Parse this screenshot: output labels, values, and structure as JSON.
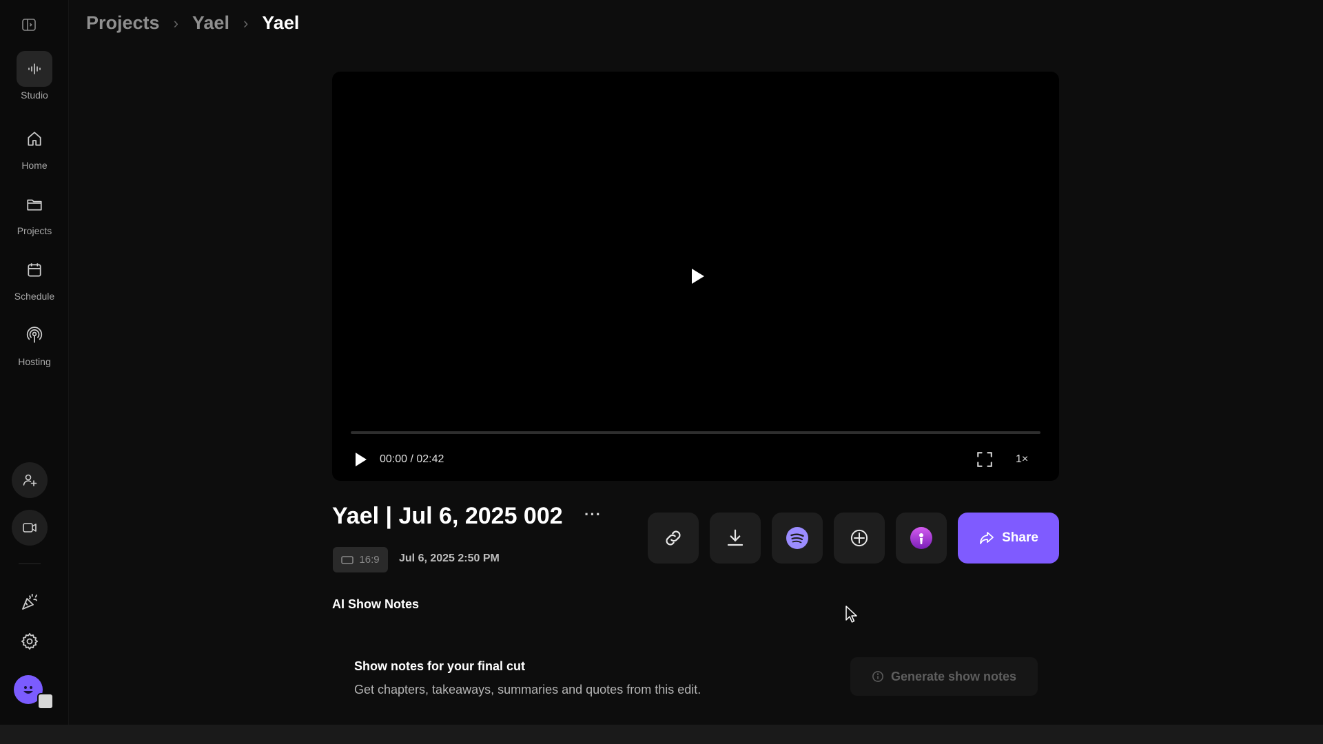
{
  "sidebar": {
    "items": [
      {
        "label": "Studio",
        "icon": "waveform-icon"
      },
      {
        "label": "Home",
        "icon": "home-icon"
      },
      {
        "label": "Projects",
        "icon": "folder-icon"
      },
      {
        "label": "Schedule",
        "icon": "calendar-icon"
      },
      {
        "label": "Hosting",
        "icon": "podcast-icon"
      }
    ]
  },
  "breadcrumb": [
    "Projects",
    "Yael",
    "Yael"
  ],
  "player": {
    "time": "00:00 / 02:42",
    "speed": "1×",
    "progress": 0
  },
  "episode": {
    "title": "Yael | Jul 6, 2025 002",
    "more": "···",
    "ratio": "16:9",
    "date": "Jul 6, 2025 2:50 PM"
  },
  "actions": {
    "share_label": "Share"
  },
  "show_notes": {
    "section_title": "AI Show Notes",
    "title": "Show notes for your final cut",
    "description": "Get chapters, takeaways, summaries and quotes from this edit.",
    "generate_label": "Generate show notes"
  },
  "colors": {
    "accent": "#7f5bff",
    "background": "#0d0d0d",
    "spotify": "#9b8cff",
    "podcasts": "#b03cd6"
  }
}
